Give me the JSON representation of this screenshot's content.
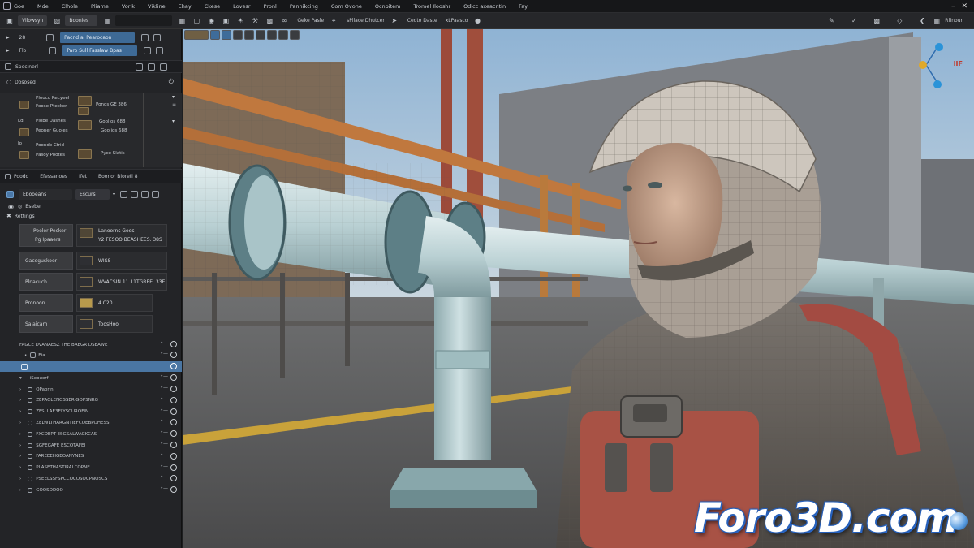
{
  "menubar": {
    "items": [
      "Goe",
      "Mde",
      "Clhole",
      "Pliame",
      "Vorlk",
      "Vikline",
      "Ehay",
      "Ckese",
      "Lovesr",
      "Pronl",
      "Pannikcing",
      "Com Ovone",
      "Ocnpitem",
      "Tromel Ilooshr",
      "Odlcc axeacntin",
      "Fay"
    ]
  },
  "toolbar": {
    "field1": "Vilowsyn",
    "field2": "Boonies",
    "field3": "Geke Pasle",
    "field4": "sPllace Dhutcer",
    "field5": "Ceoto Daste",
    "field6": "xLPaasco",
    "right_label": "Rfinour"
  },
  "left_panel": {
    "row1_label": "28",
    "row1_value": "Pacnd al Pearocaon",
    "row2_label": "Flo",
    "row2_value": "Paro Sull Fasslaw Bpas",
    "specimen_title": "Specinerl",
    "dosonsd_title": "Dososed",
    "assets": [
      {
        "name": "Plouco Recyeel",
        "sub": "Foose-Ptecker",
        "value": "Ponos GE 386"
      },
      {
        "name": "Plobe Uasnes",
        "sub": "Peoner Guoies",
        "value": "Goolios 688"
      },
      {
        "name": "Poonde Cfrid",
        "sub": "Pasoy Pootes",
        "value": "Pyce Slatis"
      }
    ],
    "asset_letters": [
      "Ld",
      "Jo",
      "Ch"
    ],
    "tabs": [
      "Poodo",
      "Efessanoes",
      "Ifet",
      "Boonor Bioreti 8"
    ],
    "prop_search": "Ebooeans",
    "prop_dropdown": "Escurs",
    "scene_label": "Bsebe",
    "scene_sub": "Rettings",
    "props": [
      {
        "label": "Poeler Pecker",
        "label2": "Pg Ipaaers",
        "value": "Lanoorns Goos",
        "value2": "Y2 FESOO BEASHEES. 38S"
      },
      {
        "label": "Gacoguskoer",
        "value": "WISS",
        "value2": ""
      },
      {
        "label": "Plnacuch",
        "value": "WVACSIN 11.11TGREE. 33E",
        "value2": ""
      },
      {
        "label": "Pronoon",
        "value": "4 C20",
        "value2": ""
      },
      {
        "label": "Salaicam",
        "value": "ToosHoo",
        "value2": ""
      }
    ],
    "outliner_header": "FAGCE DVANAESZ THE BAEGR DSEAWE",
    "outliner_sub": "Eia",
    "outliner_selected": "",
    "outliner_group": "iSeouerf",
    "outliner_items": [
      "OPaorin",
      "ZEPAOLENOSSERIGOPSNRG",
      "ZFSLLAE3ELYSCUROFIN",
      "ZELWLTHARGNTIEFCOEBPOHESS",
      "FXCOEPT-ESGSALWAGKCAS",
      "SGFEGAFE ESCOTAFEI",
      "FAREEEHGEOANYNES",
      "PLASETHASTIRALCOPNE",
      "PSEELSSFSPCCOCOSOCPNOSCS",
      "GOOSODOO"
    ]
  },
  "viewport": {
    "logo": "Foro3D.com",
    "gizmo_label": "IIF"
  },
  "colors": {
    "accent_blue": "#3e6a96",
    "selection_blue": "#4a76a3",
    "panel_bg": "#232427",
    "pipe_color": "#b8d0d3",
    "logo_outline": "#2a68c9"
  }
}
